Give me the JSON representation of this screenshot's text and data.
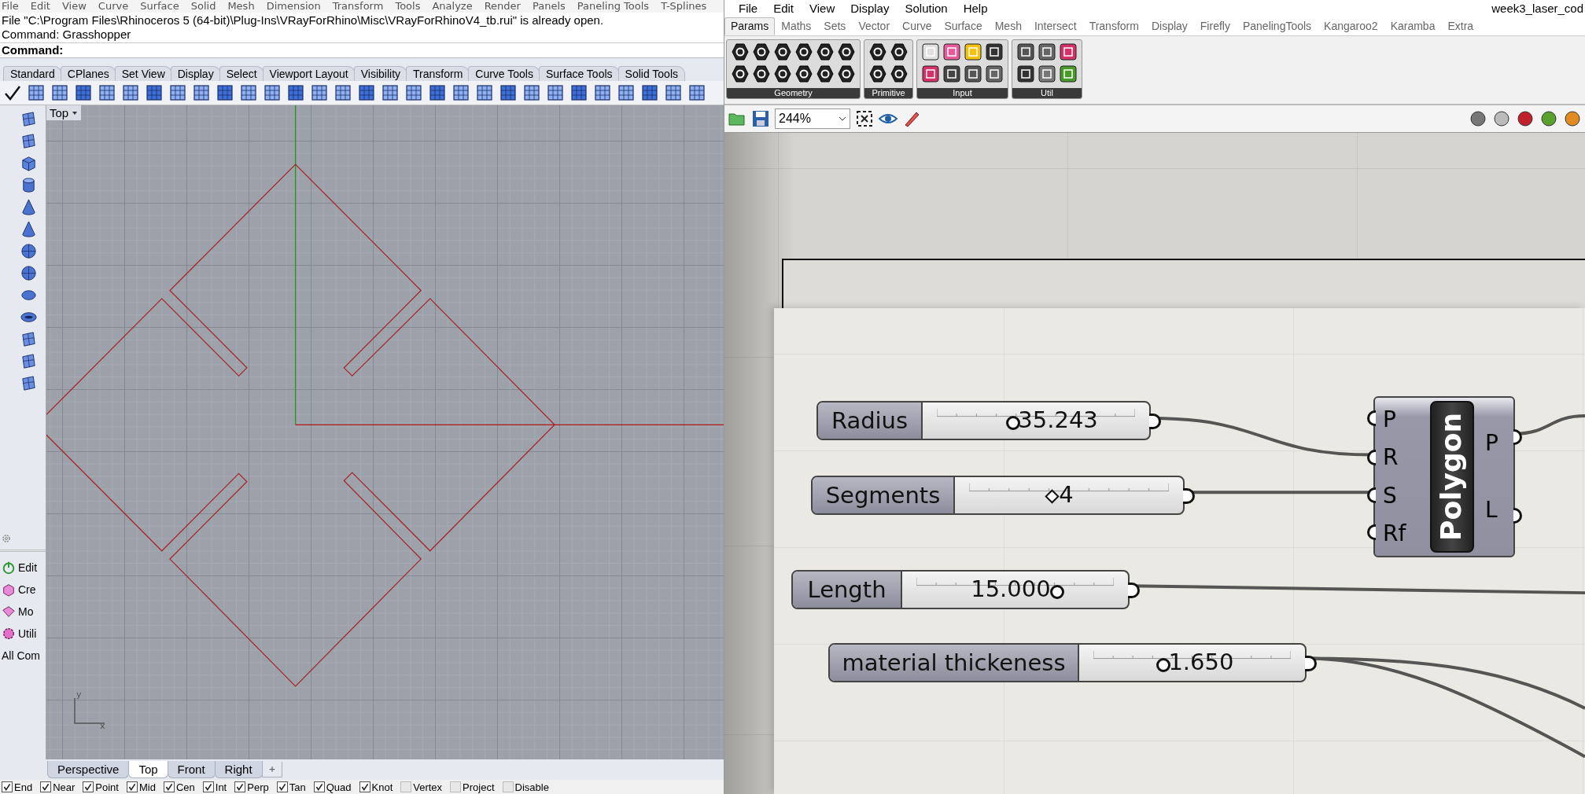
{
  "rhino": {
    "menu": [
      "File",
      "Edit",
      "View",
      "Curve",
      "Surface",
      "Solid",
      "Mesh",
      "Dimension",
      "Transform",
      "Tools",
      "Analyze",
      "Render",
      "Panels",
      "Paneling Tools",
      "T-Splines"
    ],
    "command_history": [
      "File \"C:\\Program Files\\Rhinoceros 5 (64-bit)\\Plug-Ins\\VRayForRhino\\Misc\\VRayForRhinoV4_tb.rui\" is already open.",
      "Command: Grasshopper"
    ],
    "command_prompt": "Command:",
    "toolbar_tabs": [
      "Standard",
      "CPlanes",
      "Set View",
      "Display",
      "Select",
      "Viewport Layout",
      "Visibility",
      "Transform",
      "Curve Tools",
      "Surface Tools",
      "Solid Tools"
    ],
    "side_panels": [
      "Edit",
      "Cre",
      "Mo",
      "Utili",
      "All Com"
    ],
    "viewport": {
      "name": "Top",
      "axis_x": "x",
      "axis_y": "y"
    },
    "viewport_tabs": [
      {
        "label": "Perspective",
        "selected": false
      },
      {
        "label": "Top",
        "selected": true
      },
      {
        "label": "Front",
        "selected": false
      },
      {
        "label": "Right",
        "selected": false
      }
    ],
    "osnaps": [
      {
        "label": "End",
        "checked": true
      },
      {
        "label": "Near",
        "checked": true
      },
      {
        "label": "Point",
        "checked": true
      },
      {
        "label": "Mid",
        "checked": true
      },
      {
        "label": "Cen",
        "checked": true
      },
      {
        "label": "Int",
        "checked": true
      },
      {
        "label": "Perp",
        "checked": true
      },
      {
        "label": "Tan",
        "checked": true
      },
      {
        "label": "Quad",
        "checked": true
      },
      {
        "label": "Knot",
        "checked": true
      },
      {
        "label": "Vertex",
        "checked": false
      },
      {
        "label": "Project",
        "checked": false
      },
      {
        "label": "Disable",
        "checked": false
      }
    ]
  },
  "grasshopper": {
    "menu": [
      "File",
      "Edit",
      "View",
      "Display",
      "Solution",
      "Help"
    ],
    "document_title": "week3_laser_cod",
    "tabs": [
      {
        "label": "Params",
        "selected": true
      },
      {
        "label": "Maths",
        "selected": false
      },
      {
        "label": "Sets",
        "selected": false
      },
      {
        "label": "Vector",
        "selected": false
      },
      {
        "label": "Curve",
        "selected": false
      },
      {
        "label": "Surface",
        "selected": false
      },
      {
        "label": "Mesh",
        "selected": false
      },
      {
        "label": "Intersect",
        "selected": false
      },
      {
        "label": "Transform",
        "selected": false
      },
      {
        "label": "Display",
        "selected": false
      },
      {
        "label": "Firefly",
        "selected": false
      },
      {
        "label": "PanelingTools",
        "selected": false
      },
      {
        "label": "Kangaroo2",
        "selected": false
      },
      {
        "label": "Karamba",
        "selected": false
      },
      {
        "label": "Extra",
        "selected": false
      }
    ],
    "ribbon_groups": [
      "Geometry",
      "Primitive",
      "Input",
      "Util"
    ],
    "zoom": "244%",
    "sliders": [
      {
        "label": "Radius",
        "value": "35.243",
        "kind": "float",
        "level": 0.38
      },
      {
        "label": "Segments",
        "value": "4",
        "kind": "integer",
        "level": 0.42
      },
      {
        "label": "Length",
        "value": "15.000",
        "kind": "float",
        "level": 0.71
      },
      {
        "label": "material thickeness",
        "value": "1.650",
        "kind": "float",
        "level": 0.35
      }
    ],
    "component": {
      "name": "Polygon",
      "inputs": [
        "P",
        "R",
        "S",
        "Rf"
      ],
      "outputs": [
        "P",
        "L"
      ]
    }
  }
}
